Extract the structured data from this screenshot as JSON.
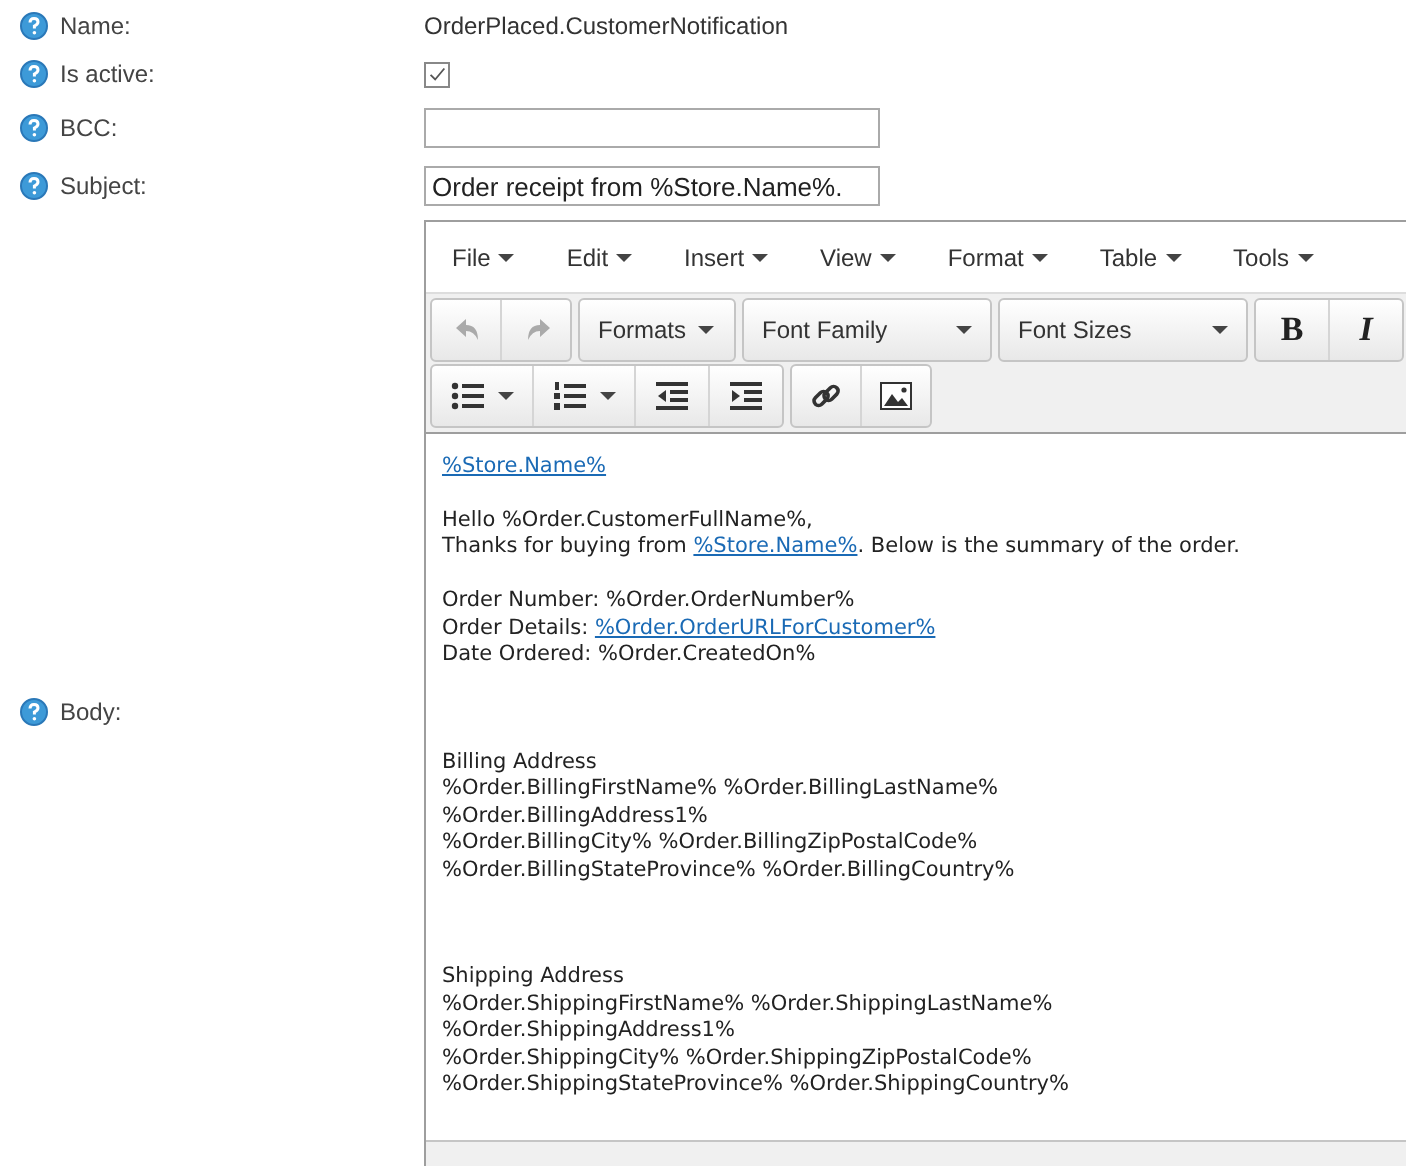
{
  "fields": [
    {
      "label": "Name:",
      "kind": "text",
      "value": "OrderPlaced.CustomerNotification"
    },
    {
      "label": "Is active:",
      "kind": "checkbox",
      "checked": true
    },
    {
      "label": "BCC:",
      "kind": "input"
    },
    {
      "label": "Subject:",
      "kind": "input",
      "value": "Order receipt from %Store.Name%."
    }
  ],
  "body": {
    "label": "Body:",
    "menu": [
      "File",
      "Edit",
      "Insert",
      "View",
      "Format",
      "Table",
      "Tools"
    ],
    "toolbar_rows": [
      [
        [
          {
            "kind": "undo",
            "disabled": true
          },
          {
            "kind": "redo",
            "disabled": true
          }
        ],
        [
          {
            "kind": "dropdown",
            "label": "Formats"
          }
        ],
        [
          {
            "kind": "select",
            "label": "Font Family"
          }
        ],
        [
          {
            "kind": "select",
            "label": "Font Sizes"
          }
        ],
        [
          {
            "kind": "bold",
            "label": "B"
          },
          {
            "kind": "italic",
            "label": "I"
          }
        ]
      ],
      [
        [
          {
            "kind": "bullet-list"
          },
          {
            "kind": "numbered-list"
          },
          {
            "kind": "outdent"
          },
          {
            "kind": "indent"
          }
        ],
        [
          {
            "kind": "link"
          },
          {
            "kind": "image"
          }
        ]
      ]
    ],
    "content": [
      {
        "kind": "line",
        "parts": [
          {
            "text": "%Store.Name%",
            "link": true
          }
        ]
      },
      {
        "kind": "blank"
      },
      {
        "kind": "line",
        "parts": [
          {
            "text": "Hello %Order.CustomerFullName%,"
          }
        ]
      },
      {
        "kind": "line",
        "parts": [
          {
            "text": "Thanks for buying from "
          },
          {
            "text": "%Store.Name%",
            "link": true
          },
          {
            "text": ". Below is the summary of the order."
          }
        ]
      },
      {
        "kind": "blank"
      },
      {
        "kind": "line",
        "parts": [
          {
            "text": "Order Number: %Order.OrderNumber%"
          }
        ]
      },
      {
        "kind": "line",
        "parts": [
          {
            "text": "Order Details: "
          },
          {
            "text": "%Order.OrderURLForCustomer%",
            "link": true
          }
        ]
      },
      {
        "kind": "line",
        "parts": [
          {
            "text": "Date Ordered: %Order.CreatedOn%"
          }
        ]
      },
      {
        "kind": "blank"
      },
      {
        "kind": "blank"
      },
      {
        "kind": "blank"
      },
      {
        "kind": "line",
        "parts": [
          {
            "text": "Billing Address"
          }
        ]
      },
      {
        "kind": "line",
        "parts": [
          {
            "text": "%Order.BillingFirstName% %Order.BillingLastName%"
          }
        ]
      },
      {
        "kind": "line",
        "parts": [
          {
            "text": "%Order.BillingAddress1%"
          }
        ]
      },
      {
        "kind": "line",
        "parts": [
          {
            "text": "%Order.BillingCity% %Order.BillingZipPostalCode%"
          }
        ]
      },
      {
        "kind": "line",
        "parts": [
          {
            "text": "%Order.BillingStateProvince% %Order.BillingCountry%"
          }
        ]
      },
      {
        "kind": "blank"
      },
      {
        "kind": "blank"
      },
      {
        "kind": "blank"
      },
      {
        "kind": "line",
        "parts": [
          {
            "text": "Shipping Address"
          }
        ]
      },
      {
        "kind": "line",
        "parts": [
          {
            "text": "%Order.ShippingFirstName% %Order.ShippingLastName%"
          }
        ]
      },
      {
        "kind": "line",
        "parts": [
          {
            "text": "%Order.ShippingAddress1%"
          }
        ]
      },
      {
        "kind": "line",
        "parts": [
          {
            "text": "%Order.ShippingCity% %Order.ShippingZipPostalCode%"
          }
        ]
      },
      {
        "kind": "line",
        "parts": [
          {
            "text": "%Order.ShippingStateProvince% %Order.ShippingCountry%"
          }
        ]
      }
    ]
  }
}
